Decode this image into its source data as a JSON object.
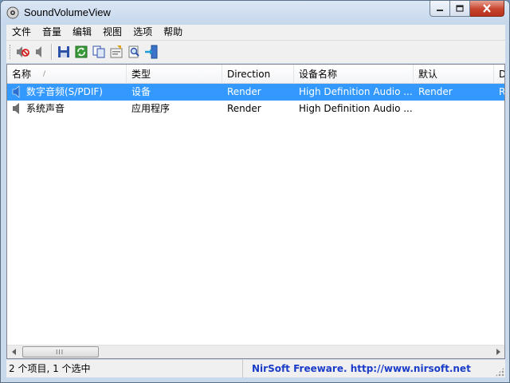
{
  "window": {
    "title": "SoundVolumeView"
  },
  "menu": [
    "文件",
    "音量",
    "编辑",
    "视图",
    "选项",
    "帮助"
  ],
  "toolbar": {
    "buttons": [
      {
        "name": "mute-button",
        "icon": "speaker-mute-icon"
      },
      {
        "name": "unmute-button",
        "icon": "speaker-icon"
      },
      {
        "name": "save-button",
        "icon": "floppy-disk-icon"
      },
      {
        "name": "refresh-button",
        "icon": "refresh-icon"
      },
      {
        "name": "copy-button",
        "icon": "copy-icon"
      },
      {
        "name": "properties-button",
        "icon": "properties-icon"
      },
      {
        "name": "find-button",
        "icon": "find-icon"
      },
      {
        "name": "exit-button",
        "icon": "exit-icon"
      }
    ]
  },
  "list": {
    "columns": [
      "名称",
      "类型",
      "Direction",
      "设备名称",
      "默认",
      "D"
    ],
    "sort_indicator": "/",
    "rows": [
      {
        "name": "数字音频(S/PDIF)",
        "type": "设备",
        "direction": "Render",
        "device": "High Definition Audio ...",
        "default": "Render",
        "extra": "R",
        "selected": true
      },
      {
        "name": "系统声音",
        "type": "应用程序",
        "direction": "Render",
        "device": "High Definition Audio ...",
        "default": "",
        "extra": "",
        "selected": false
      }
    ]
  },
  "scrollbar": {
    "grip": "III"
  },
  "status": {
    "summary": "2 个项目, 1 个选中",
    "credit": "NirSoft Freeware.  http://www.nirsoft.net"
  },
  "colors": {
    "selection": "#3399ff",
    "link": "#1a3cc8"
  }
}
